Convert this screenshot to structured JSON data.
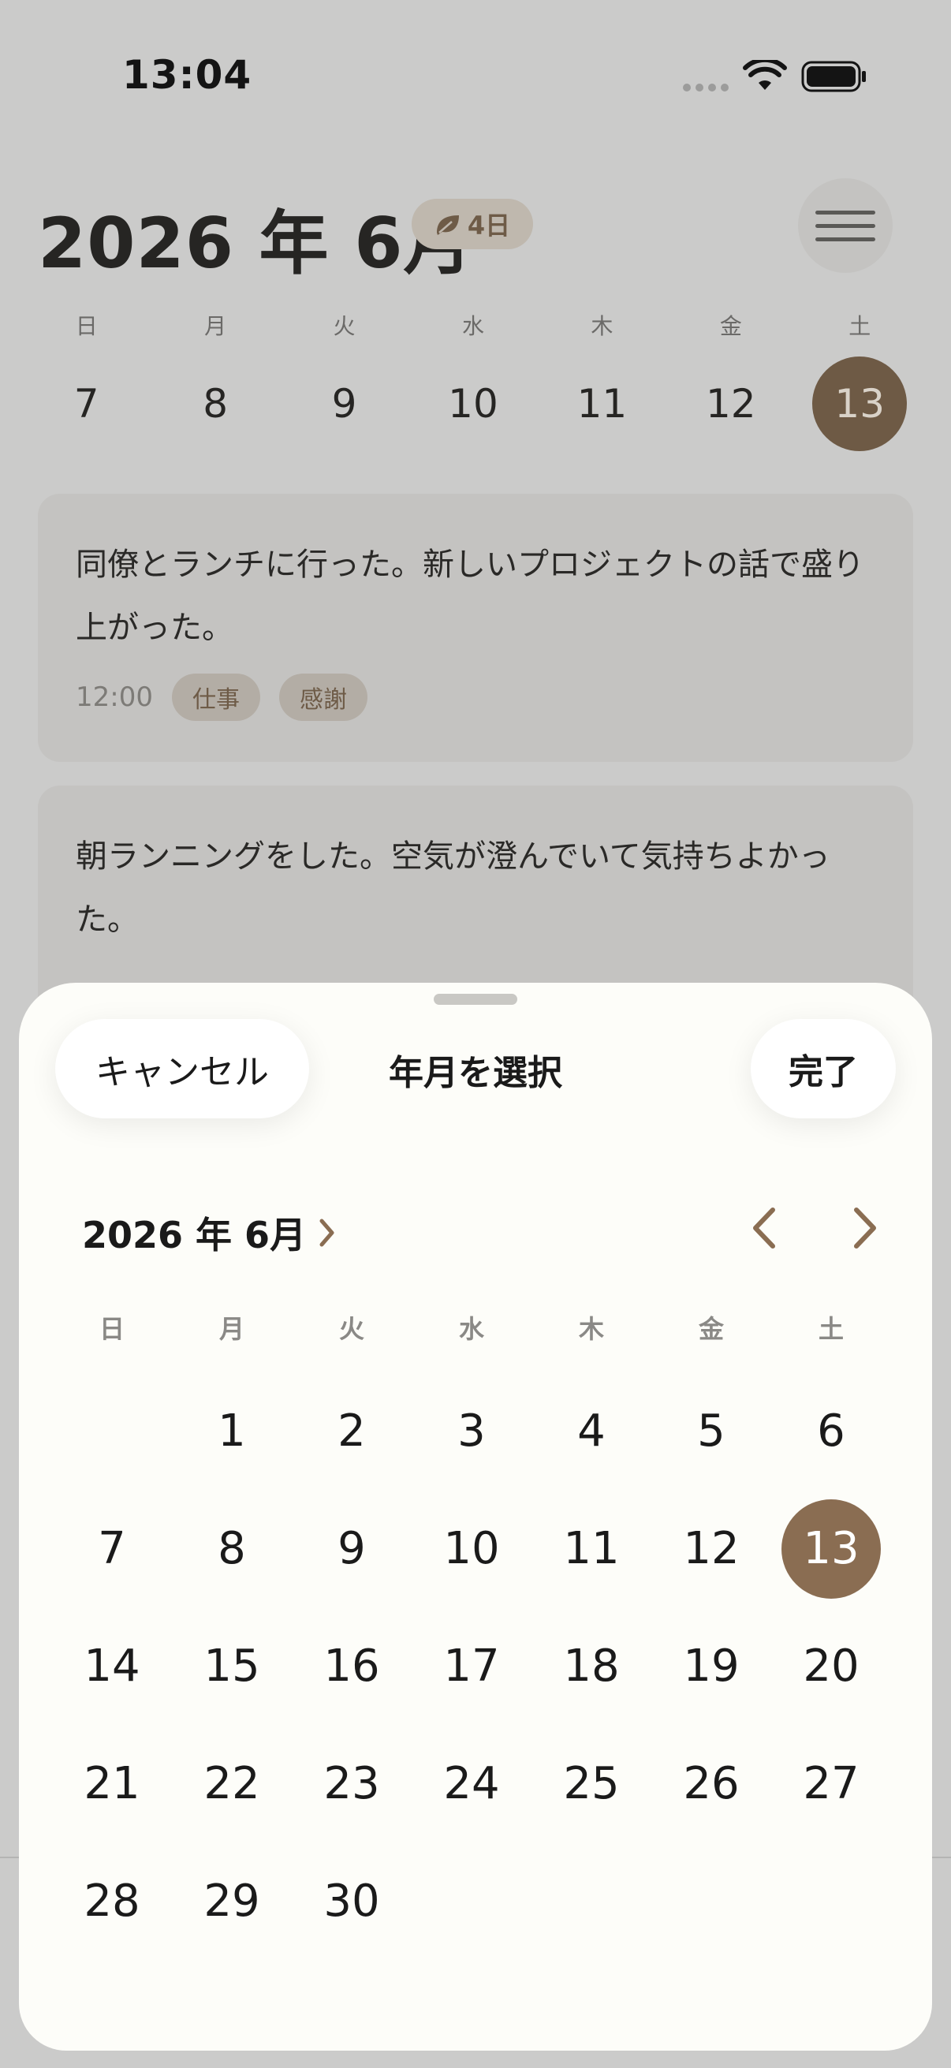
{
  "colors": {
    "accent": "#8a6d52",
    "accent_dim": "#6e5a45",
    "sheet_bg": "#fdfdf9"
  },
  "status_bar": {
    "time": "13:04"
  },
  "header": {
    "month_title": "2026 年 6月",
    "streak_label": "4日"
  },
  "week_strip": {
    "weekdays": [
      "日",
      "月",
      "火",
      "水",
      "木",
      "金",
      "土"
    ],
    "days": [
      "7",
      "8",
      "9",
      "10",
      "11",
      "12",
      "13"
    ],
    "selected_index": 6
  },
  "entries": [
    {
      "text": "同僚とランチに行った。新しいプロジェクトの話で盛り上がった。",
      "time": "12:00",
      "tags": [
        "仕事",
        "感謝"
      ]
    },
    {
      "text": "朝ランニングをした。空気が澄んでいて気持ちよかった。"
    }
  ],
  "sheet": {
    "cancel_label": "キャンセル",
    "title": "年月を選択",
    "done_label": "完了",
    "month_label": "2026 年 6月",
    "weekdays": [
      "日",
      "月",
      "火",
      "水",
      "木",
      "金",
      "土"
    ],
    "days": [
      "",
      "1",
      "2",
      "3",
      "4",
      "5",
      "6",
      "7",
      "8",
      "9",
      "10",
      "11",
      "12",
      "13",
      "14",
      "15",
      "16",
      "17",
      "18",
      "19",
      "20",
      "21",
      "22",
      "23",
      "24",
      "25",
      "26",
      "27",
      "28",
      "29",
      "30",
      "",
      "",
      "",
      ""
    ],
    "selected_day": "13"
  },
  "icons": [
    "leaf-icon",
    "menu-icon",
    "wifi-icon",
    "battery-icon",
    "chevron-right-icon",
    "chevron-left-icon"
  ]
}
